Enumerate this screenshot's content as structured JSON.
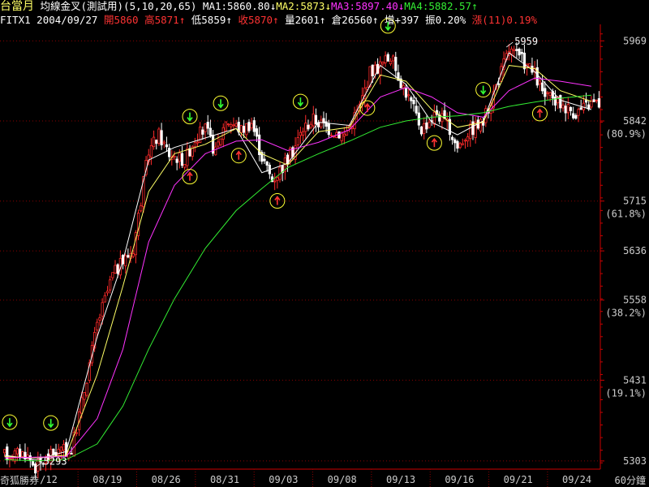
{
  "header": {
    "title": "台當月",
    "indicator": "均線金叉(測試用)(5,10,20,65)",
    "ma1": "MA1:5860.80↓",
    "ma2": "MA2:5873↓",
    "ma3": "MA3:5897.40↓",
    "ma4": "MA4:5882.57↑",
    "symbol": "FITX1",
    "date": "2004/09/27",
    "open": "開5860",
    "high": "高5871↑",
    "low": "低5859↑",
    "close": "收5870↑",
    "volume": "量2601↑",
    "oi": "倉26560↑",
    "oi_change": "增+397",
    "amplitude": "振0.20%",
    "change": "漲(11)0.19%"
  },
  "footer": {
    "source": "奇狐勝券",
    "interval": "60分鐘"
  },
  "colors": {
    "up": "#ff2a2a",
    "down": "#ffffff",
    "ma1": "#ffffff",
    "ma2": "#ffff66",
    "ma3": "#ff33ff",
    "ma4": "#33ee33",
    "grid": "#8b0000",
    "axis": "#cc0000",
    "label": "#cccccc"
  },
  "chart_data": {
    "type": "candlestick",
    "y_axis": {
      "ylim": [
        5290,
        5990
      ],
      "ticks": [
        {
          "value": 5969,
          "label": "5969",
          "pct": ""
        },
        {
          "value": 5842,
          "label": "5842",
          "pct": "(80.9%)"
        },
        {
          "value": 5715,
          "label": "5715",
          "pct": "(61.8%)"
        },
        {
          "value": 5636,
          "label": "5636",
          "pct": ""
        },
        {
          "value": 5558,
          "label": "5558",
          "pct": "(38.2%)"
        },
        {
          "value": 5431,
          "label": "5431",
          "pct": "(19.1%)"
        },
        {
          "value": 5303,
          "label": "5303",
          "pct": ""
        }
      ]
    },
    "x_labels": [
      "/12",
      "08/19",
      "08/26",
      "08/31",
      "09/03",
      "09/08",
      "09/13",
      "09/16",
      "09/21",
      "09/24"
    ],
    "annotations": [
      {
        "text": "5293",
        "value": 5293,
        "at": 12
      },
      {
        "text": "5959",
        "value": 5959,
        "at": 195
      }
    ],
    "signals": [
      {
        "kind": "buy",
        "at": 2
      },
      {
        "kind": "buy",
        "at": 18
      },
      {
        "kind": "sell",
        "at": 12
      },
      {
        "kind": "sell",
        "at": 72
      },
      {
        "kind": "buy",
        "at": 72
      },
      {
        "kind": "sell",
        "at": 91
      },
      {
        "kind": "buy",
        "at": 84
      },
      {
        "kind": "sell",
        "at": 106
      },
      {
        "kind": "buy",
        "at": 115
      },
      {
        "kind": "sell",
        "at": 141
      },
      {
        "kind": "buy",
        "at": 149
      },
      {
        "kind": "sell",
        "at": 167
      },
      {
        "kind": "buy",
        "at": 186
      },
      {
        "kind": "sell",
        "at": 208
      }
    ],
    "price_path": [
      [
        0,
        5312
      ],
      [
        8,
        5316
      ],
      [
        12,
        5293
      ],
      [
        20,
        5318
      ],
      [
        26,
        5320
      ],
      [
        30,
        5395
      ],
      [
        36,
        5520
      ],
      [
        42,
        5598
      ],
      [
        50,
        5640
      ],
      [
        56,
        5795
      ],
      [
        60,
        5820
      ],
      [
        64,
        5790
      ],
      [
        70,
        5780
      ],
      [
        74,
        5815
      ],
      [
        78,
        5830
      ],
      [
        82,
        5792
      ],
      [
        86,
        5845
      ],
      [
        92,
        5828
      ],
      [
        96,
        5840
      ],
      [
        100,
        5785
      ],
      [
        104,
        5748
      ],
      [
        108,
        5770
      ],
      [
        112,
        5795
      ],
      [
        116,
        5830
      ],
      [
        120,
        5845
      ],
      [
        126,
        5830
      ],
      [
        132,
        5820
      ],
      [
        138,
        5865
      ],
      [
        142,
        5920
      ],
      [
        146,
        5930
      ],
      [
        150,
        5945
      ],
      [
        154,
        5905
      ],
      [
        158,
        5870
      ],
      [
        162,
        5830
      ],
      [
        168,
        5855
      ],
      [
        172,
        5835
      ],
      [
        176,
        5800
      ],
      [
        180,
        5825
      ],
      [
        186,
        5840
      ],
      [
        192,
        5910
      ],
      [
        196,
        5955
      ],
      [
        202,
        5935
      ],
      [
        206,
        5915
      ],
      [
        210,
        5880
      ],
      [
        216,
        5870
      ],
      [
        222,
        5855
      ],
      [
        228,
        5870
      ]
    ],
    "ma_lines": [
      {
        "name": "MA1",
        "points": [
          [
            0,
            5312
          ],
          [
            12,
            5305
          ],
          [
            24,
            5318
          ],
          [
            36,
            5500
          ],
          [
            46,
            5620
          ],
          [
            56,
            5780
          ],
          [
            66,
            5800
          ],
          [
            78,
            5815
          ],
          [
            90,
            5830
          ],
          [
            100,
            5760
          ],
          [
            110,
            5775
          ],
          [
            122,
            5840
          ],
          [
            134,
            5835
          ],
          [
            146,
            5930
          ],
          [
            156,
            5900
          ],
          [
            166,
            5840
          ],
          [
            176,
            5820
          ],
          [
            186,
            5842
          ],
          [
            196,
            5950
          ],
          [
            206,
            5920
          ],
          [
            216,
            5875
          ],
          [
            228,
            5860
          ]
        ]
      },
      {
        "name": "MA2",
        "points": [
          [
            0,
            5310
          ],
          [
            12,
            5308
          ],
          [
            24,
            5312
          ],
          [
            36,
            5440
          ],
          [
            46,
            5580
          ],
          [
            56,
            5730
          ],
          [
            66,
            5790
          ],
          [
            78,
            5805
          ],
          [
            90,
            5830
          ],
          [
            100,
            5790
          ],
          [
            110,
            5772
          ],
          [
            122,
            5825
          ],
          [
            134,
            5832
          ],
          [
            146,
            5915
          ],
          [
            156,
            5905
          ],
          [
            166,
            5860
          ],
          [
            176,
            5832
          ],
          [
            186,
            5840
          ],
          [
            196,
            5930
          ],
          [
            206,
            5925
          ],
          [
            216,
            5890
          ],
          [
            228,
            5873
          ]
        ]
      },
      {
        "name": "MA3",
        "points": [
          [
            0,
            5308
          ],
          [
            12,
            5309
          ],
          [
            24,
            5310
          ],
          [
            36,
            5370
          ],
          [
            46,
            5480
          ],
          [
            56,
            5650
          ],
          [
            66,
            5740
          ],
          [
            78,
            5790
          ],
          [
            90,
            5810
          ],
          [
            100,
            5812
          ],
          [
            110,
            5795
          ],
          [
            122,
            5808
          ],
          [
            134,
            5828
          ],
          [
            146,
            5880
          ],
          [
            156,
            5895
          ],
          [
            166,
            5880
          ],
          [
            176,
            5855
          ],
          [
            186,
            5848
          ],
          [
            196,
            5890
          ],
          [
            206,
            5910
          ],
          [
            216,
            5905
          ],
          [
            228,
            5897
          ]
        ]
      },
      {
        "name": "MA4",
        "points": [
          [
            0,
            5305
          ],
          [
            12,
            5303
          ],
          [
            24,
            5305
          ],
          [
            36,
            5330
          ],
          [
            46,
            5390
          ],
          [
            56,
            5480
          ],
          [
            66,
            5560
          ],
          [
            78,
            5640
          ],
          [
            90,
            5700
          ],
          [
            100,
            5735
          ],
          [
            110,
            5768
          ],
          [
            122,
            5790
          ],
          [
            134,
            5810
          ],
          [
            146,
            5832
          ],
          [
            156,
            5842
          ],
          [
            166,
            5848
          ],
          [
            176,
            5850
          ],
          [
            186,
            5855
          ],
          [
            196,
            5865
          ],
          [
            206,
            5872
          ],
          [
            216,
            5878
          ],
          [
            228,
            5883
          ]
        ]
      }
    ]
  }
}
